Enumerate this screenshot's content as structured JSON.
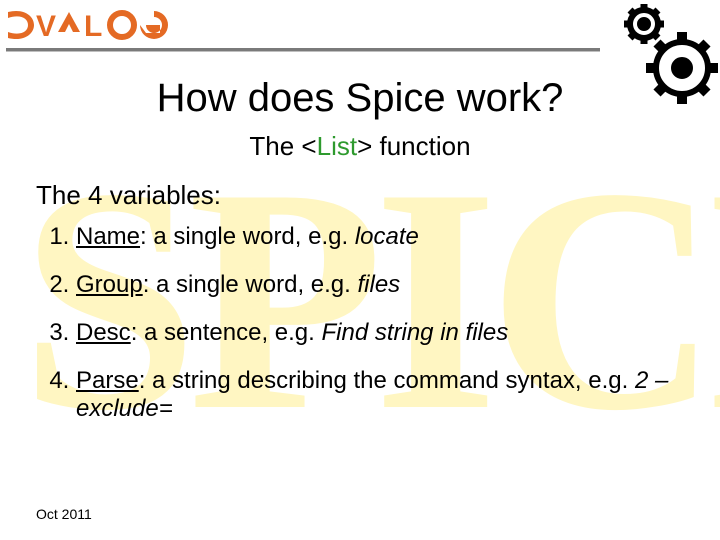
{
  "brand": "DYALOG",
  "title": "How does Spice work?",
  "subtitle_parts": {
    "pre": "The <",
    "mid": "List",
    "post": "> function"
  },
  "watermark": "SPICE",
  "lead": "The 4 variables:",
  "items": [
    {
      "term": "Name",
      "body": ": a single word, e.g. ",
      "ex": "locate"
    },
    {
      "term": "Group",
      "body": ": a single word, e.g. ",
      "ex": "files"
    },
    {
      "term": "Desc",
      "body": ": a sentence, e.g. ",
      "ex": "Find string in files"
    },
    {
      "term": "Parse",
      "body": ": a string describing the command syntax, e.g. ",
      "ex": "2   –exclude="
    }
  ],
  "footer": "Oct  2011",
  "colors": {
    "accent": "#e46a24",
    "rule": "#7a7a7a",
    "wm": "#fff6c2",
    "green": "#2e9a2e"
  }
}
